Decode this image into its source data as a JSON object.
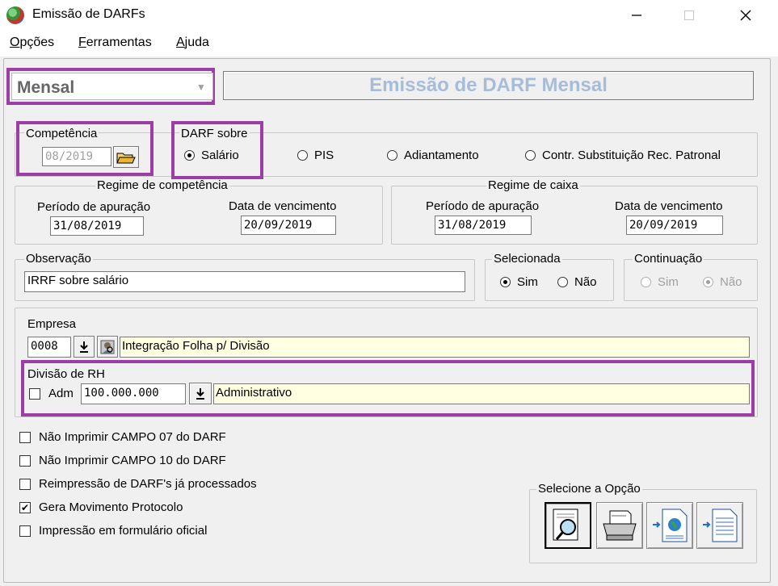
{
  "window": {
    "title": "Emissão de DARFs",
    "minimize": "—",
    "maximize": "☐",
    "close": "✕"
  },
  "menu": [
    {
      "label": "Opções",
      "key": "O",
      "rest": "pções"
    },
    {
      "label": "Ferramentas",
      "key": "F",
      "rest": "erramentas"
    },
    {
      "label": "Ajuda",
      "key": "A",
      "rest": "juda"
    }
  ],
  "mode_select": {
    "value": "Mensal"
  },
  "header_title": "Emissão de DARF Mensal",
  "competencia": {
    "legend": "Competência",
    "value": "08/2019"
  },
  "darf_sobre": {
    "legend": "DARF sobre",
    "options": [
      "Salário",
      "PIS",
      "Adiantamento",
      "Contr. Substituição Rec. Patronal"
    ],
    "selected": "Salário"
  },
  "regime_competencia": {
    "legend": "Regime de competência",
    "periodo_label": "Período de apuração",
    "periodo_value": "31/08/2019",
    "vencimento_label": "Data de vencimento",
    "vencimento_value": "20/09/2019"
  },
  "regime_caixa": {
    "legend": "Regime de caixa",
    "periodo_label": "Período de apuração",
    "periodo_value": "31/08/2019",
    "vencimento_label": "Data de vencimento",
    "vencimento_value": "20/09/2019"
  },
  "observacao": {
    "legend": "Observação",
    "value": "IRRF sobre salário"
  },
  "selecionada": {
    "legend": "Selecionada",
    "sim": "Sim",
    "nao": "Não",
    "selected": "Sim"
  },
  "continuacao": {
    "legend": "Continuação",
    "sim": "Sim",
    "nao": "Não",
    "selected": "Não",
    "disabled": true
  },
  "empresa": {
    "label": "Empresa",
    "code": "0008",
    "name": "Integração Folha p/ Divisão"
  },
  "divisao": {
    "label": "Divisão de RH",
    "adm_label": "Adm",
    "adm_checked": false,
    "code": "100.000.000",
    "name": "Administrativo"
  },
  "checkboxes": [
    {
      "label": "Não Imprimir CAMPO 07 do DARF",
      "checked": false
    },
    {
      "label": "Não Imprimir CAMPO 10 do DARF",
      "checked": false
    },
    {
      "label": "Reimpressão de DARF's já processados",
      "checked": false
    },
    {
      "label": "Gera Movimento Protocolo",
      "checked": true
    },
    {
      "label": "Impressão em formulário oficial",
      "checked": false
    }
  ],
  "selecione": {
    "legend": "Selecione a Opção"
  },
  "icons": {
    "folder": "folder-open-icon",
    "download": "download-arrow-icon",
    "search_person": "person-search-icon",
    "preview": "magnifier-icon",
    "printer": "printer-icon",
    "web_export": "web-export-icon",
    "file_export": "document-export-icon"
  },
  "colors": {
    "highlight": "#9b3fa5",
    "header_text": "#a7bcd6",
    "yellow_field": "#ffffe1"
  }
}
